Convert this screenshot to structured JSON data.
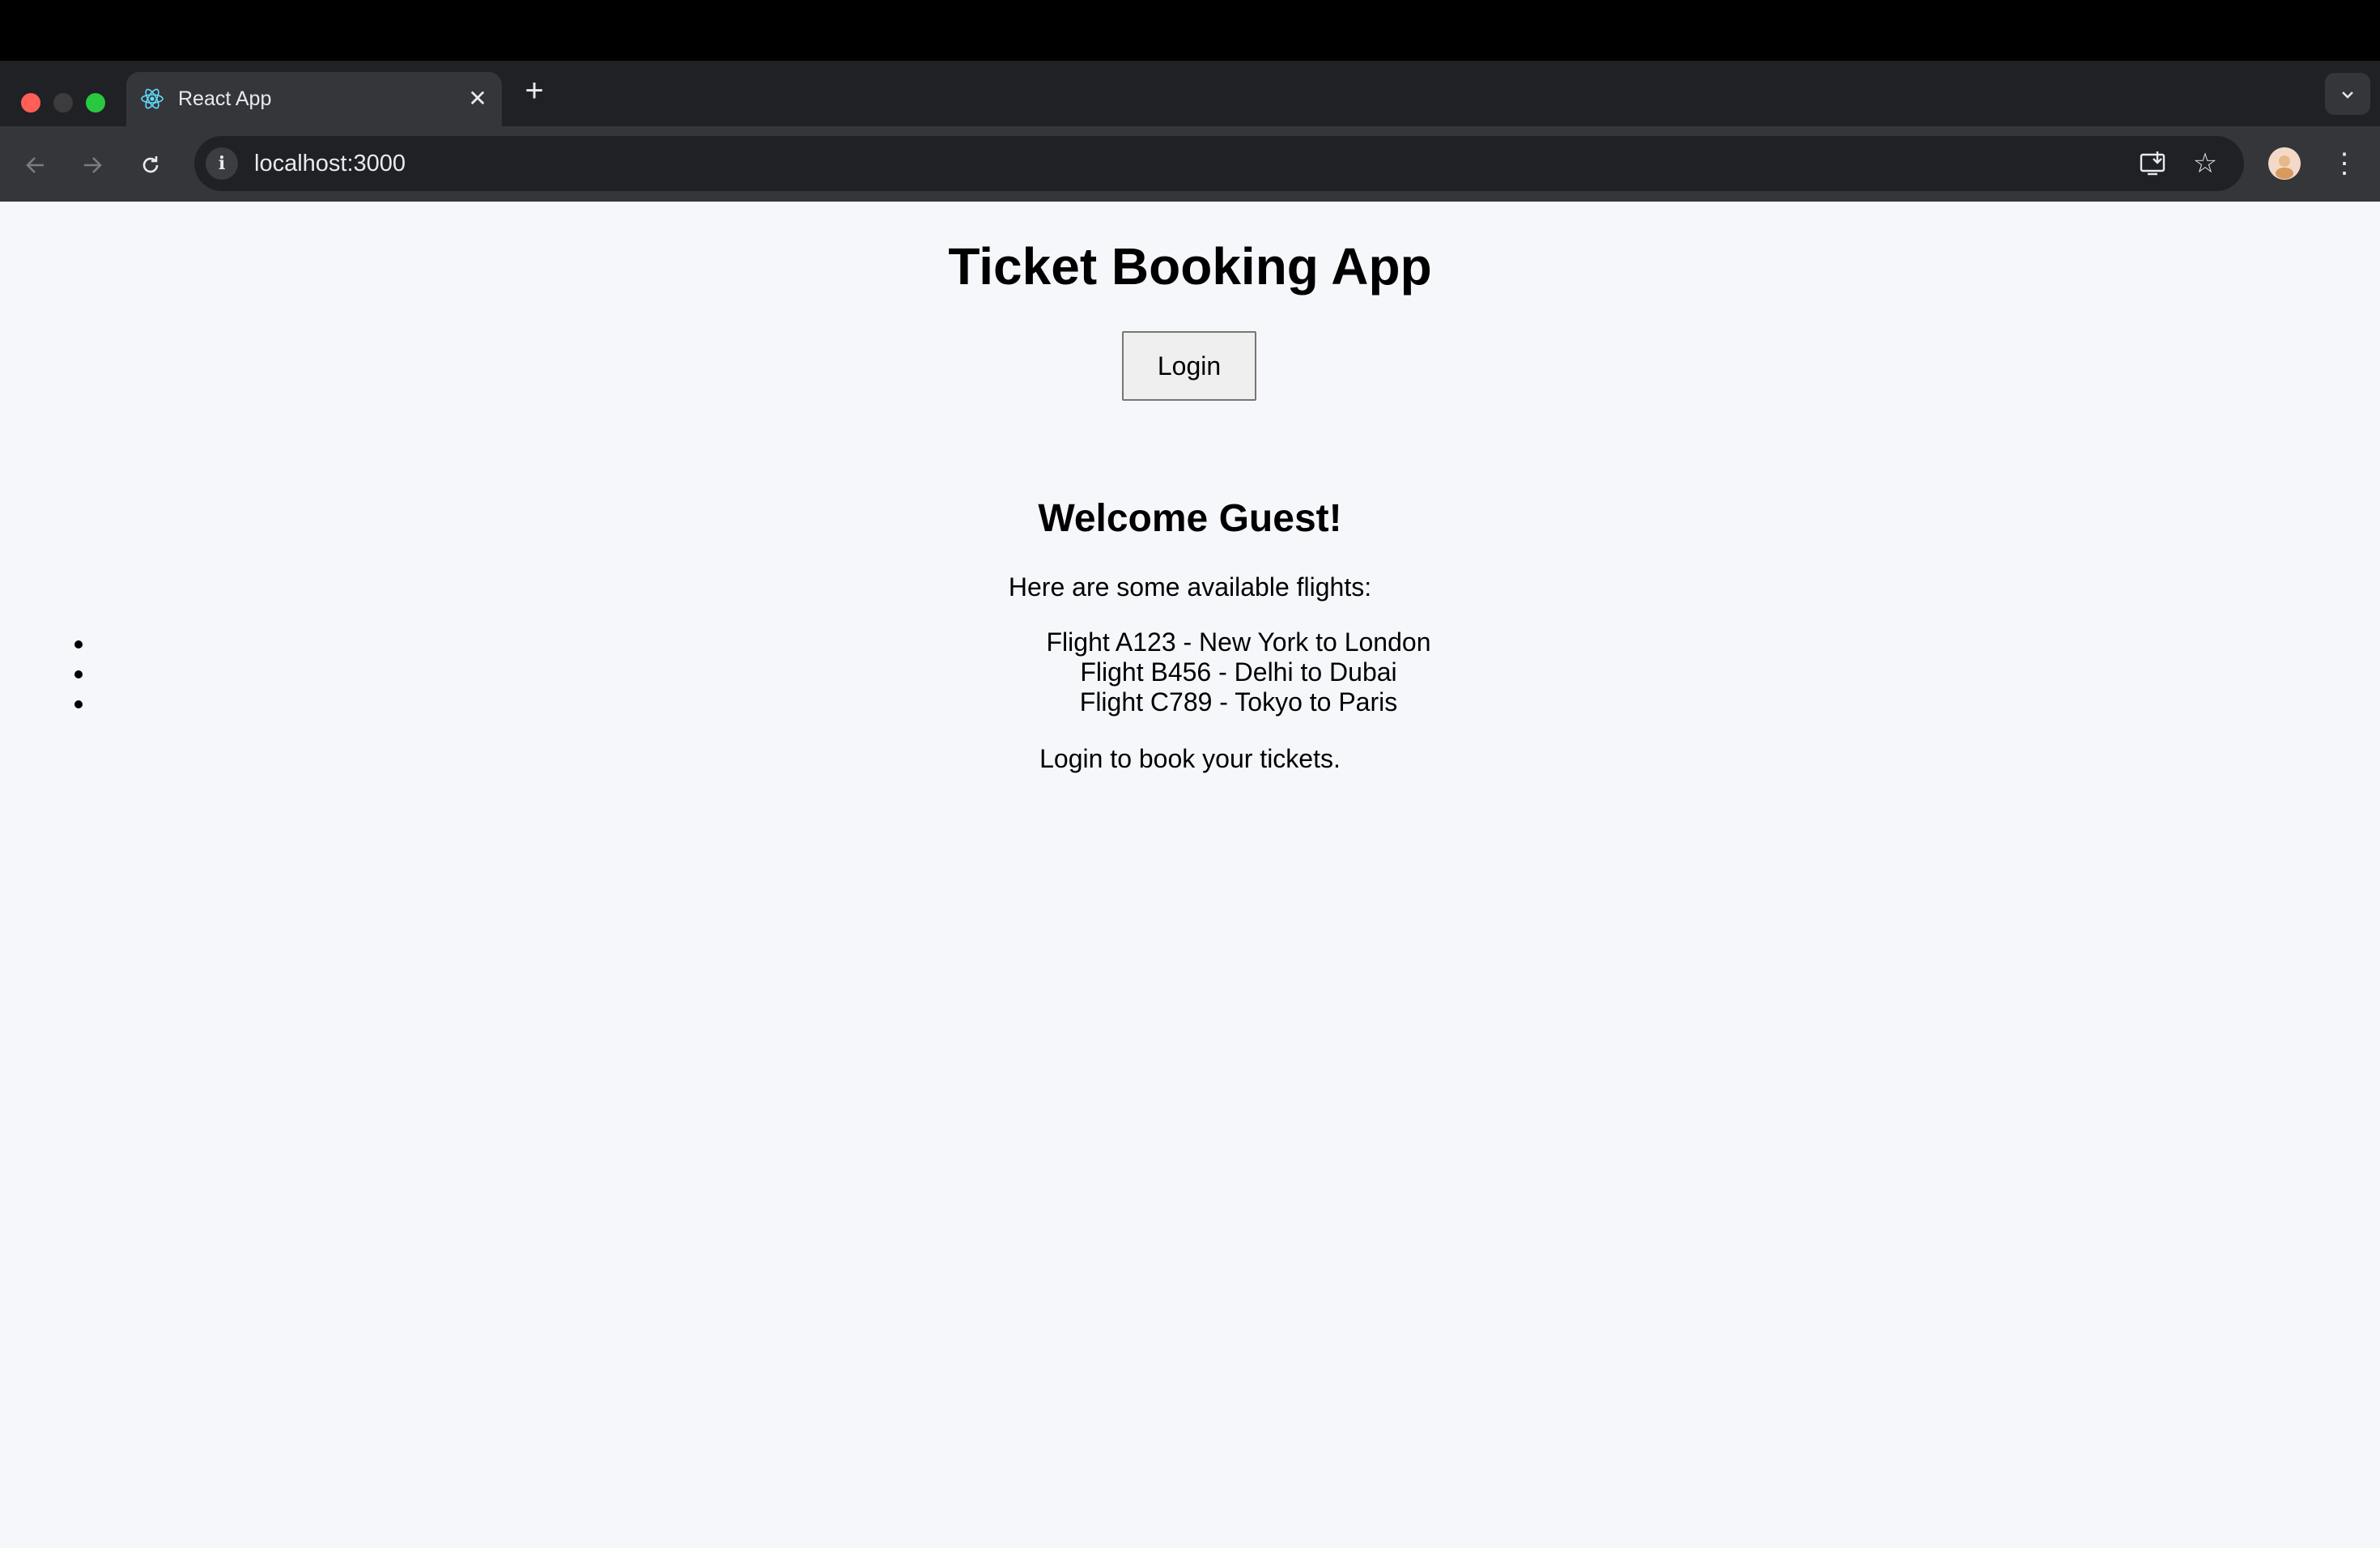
{
  "browser": {
    "tab": {
      "title": "React App"
    },
    "omnibox": {
      "url": "localhost:3000"
    },
    "icons": {
      "favicon": "react-logo-icon",
      "close": "close-icon",
      "new_tab": "plus-icon",
      "tab_search": "chevron-down-icon",
      "back": "arrow-left-icon",
      "forward": "arrow-right-icon",
      "reload": "reload-icon",
      "site_info": "info-icon",
      "install": "install-app-icon",
      "bookmark": "star-icon",
      "profile": "avatar",
      "menu": "kebab-menu-icon"
    }
  },
  "page": {
    "title": "Ticket Booking App",
    "login_label": "Login",
    "welcome": "Welcome Guest!",
    "intro": "Here are some available flights:",
    "flights": [
      "Flight A123 - New York to London",
      "Flight B456 - Delhi to Dubai",
      "Flight C789 - Tokyo to Paris"
    ],
    "cta": "Login to book your tickets."
  },
  "colors": {
    "page_background": "#f6f7fa",
    "toolbar": "#35363a",
    "tabstrip": "#202124"
  }
}
